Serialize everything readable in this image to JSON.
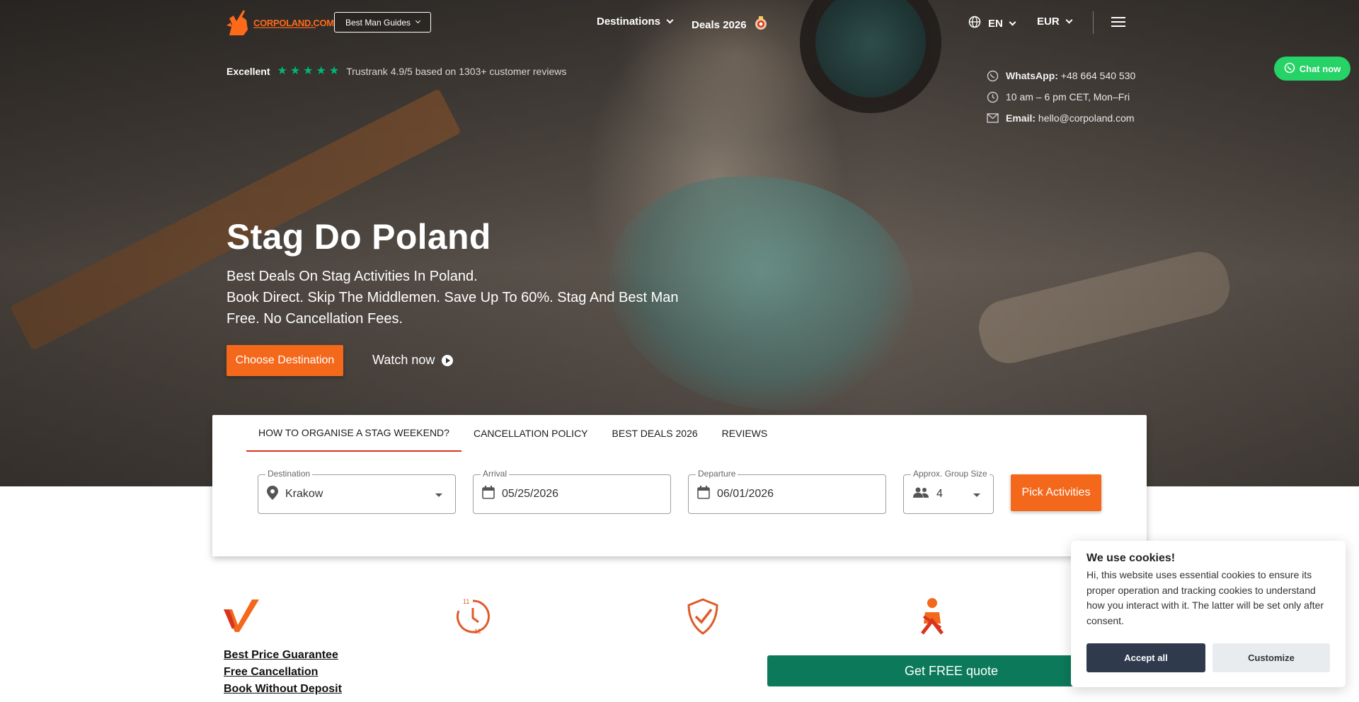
{
  "header": {
    "logo_text": "CORPOLAND.COM",
    "guides_button": "Best Man Guides",
    "nav": [
      {
        "label": "Destinations"
      },
      {
        "label": "Deals 2026"
      }
    ],
    "language": "EN",
    "currency": "EUR"
  },
  "trust": {
    "label": "Excellent",
    "rating_text": "Trustrank 4.9/5 based on 1303+ customer reviews",
    "star_color": "#00b67a"
  },
  "contact": {
    "whatsapp_label": "WhatsApp:",
    "whatsapp_value": "+48 664 540 530",
    "hours": "10 am – 6 pm CET, Mon–Fri",
    "email_label": "Email:",
    "email_value": "hello@corpoland.com"
  },
  "chat": {
    "label": "Chat now",
    "color": "#25d366"
  },
  "hero": {
    "title": "Stag Do Poland",
    "subtitle_line1": "Best Deals On Stag Activities In Poland.",
    "subtitle_line2": "Book Direct. Skip The Middlemen. Save Up To 60%. Stag And Best Man Free. No Cancellation Fees.",
    "cta_primary": "Choose Destination",
    "cta_watch": "Watch now",
    "accent": "#f4681c"
  },
  "panel": {
    "tabs": [
      {
        "label": "How to organise a stag weekend?"
      },
      {
        "label": "Cancellation Policy"
      },
      {
        "label": "Best Deals 2026"
      },
      {
        "label": "Reviews"
      }
    ],
    "fields": {
      "destination": {
        "label": "Destination",
        "value": "Krakow"
      },
      "arrival": {
        "label": "Arrival",
        "value": "05/25/2026"
      },
      "departure": {
        "label": "Departure",
        "value": "06/01/2026"
      },
      "group": {
        "label": "Approx. Group Size",
        "value": "4"
      }
    },
    "submit": "Pick Activities"
  },
  "features": {
    "icons": [
      "checkmark-icon",
      "clock-icon",
      "shield-check-icon",
      "person-icon"
    ],
    "links": [
      "Best Price Guarantee",
      "Free Cancellation",
      "Book Without Deposit"
    ],
    "quote_button": "Get FREE quote",
    "quote_color": "#0c7a5a"
  },
  "cookie": {
    "title": "We use cookies!",
    "text": "Hi, this website uses essential cookies to ensure its proper operation and tracking cookies to understand how you interact with it. The latter will be set only after consent.",
    "accept": "Accept all",
    "customize": "Customize"
  }
}
